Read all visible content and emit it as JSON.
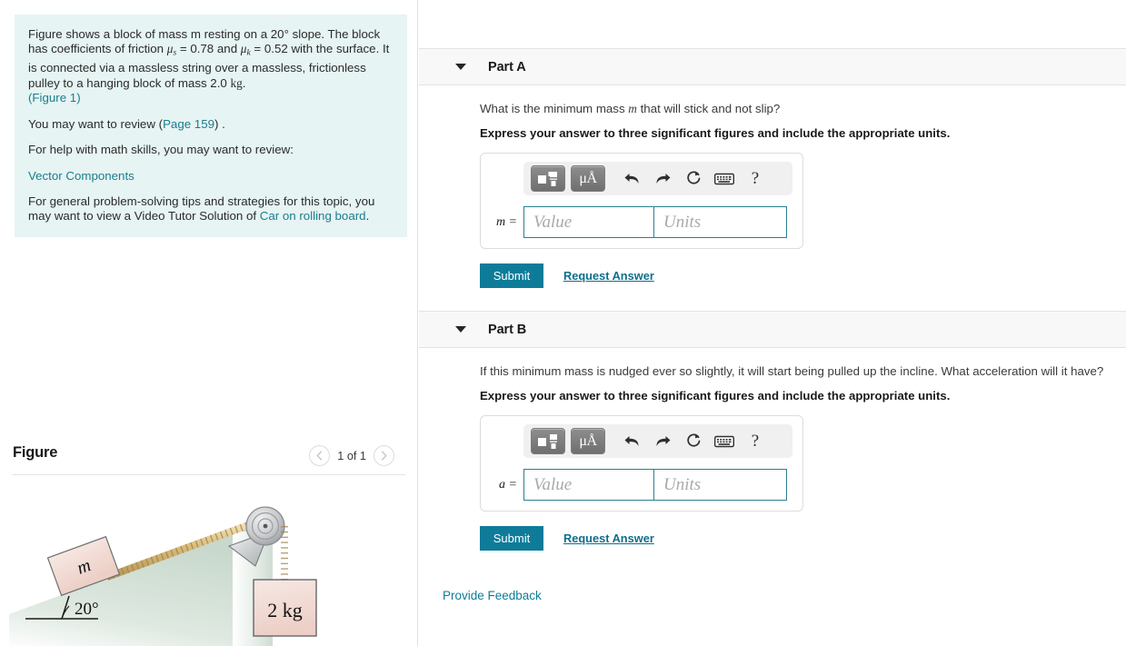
{
  "problem": {
    "paragraph1_a": "Figure shows a block of mass m resting on a 20",
    "paragraph1_deg": "°",
    "paragraph1_b": " slope. The block has coefficients of friction ",
    "mu_symbol": "μ",
    "mu_s_sub": "s",
    "mu_s_value": " = 0.78 and ",
    "mu_k_sub": "k",
    "mu_k_value": " = 0.52 with the surface. It is connected via a massless string over a massless, frictionless pulley to a hanging block of mass 2.0 ",
    "kg_unit": "kg",
    "paragraph1_end": ".",
    "figure_link": "(Figure 1)",
    "review_prefix": "You may want to review (",
    "page_link": "Page 159",
    "review_suffix": ") .",
    "math_skills_text": "For help with math skills, you may want to review:",
    "vector_components_link": "Vector Components",
    "tips_prefix": "For general problem-solving tips and strategies for this topic, you may want to view a Video Tutor Solution of ",
    "video_link": "Car on rolling board",
    "tips_suffix": "."
  },
  "figure": {
    "title": "Figure",
    "pager_label": "1 of 1",
    "prev_icon": "chevron-left-icon",
    "next_icon": "chevron-right-icon",
    "diagram": {
      "block_label": "m",
      "angle_label": "20°",
      "hanging_block_label": "2 kg",
      "incline_color": "#d9e4dc",
      "block_fill": "#f2ded9",
      "rope_color": "#d9bc7f",
      "pulley_color": "#c5c7c9"
    }
  },
  "parts": [
    {
      "id": "part-a",
      "title": "Part A",
      "caret_icon": "caret-down-icon",
      "question": "What is the minimum mass m that will stick and not slip?",
      "question_pre": "What is the minimum mass ",
      "question_var": "m",
      "question_post": " that will stick and not slip?",
      "instruction": "Express your answer to three significant figures and include the appropriate units.",
      "answer_label": "m =",
      "value_placeholder": "Value",
      "units_placeholder": "Units",
      "value_current": "",
      "units_current": "",
      "submit_label": "Submit",
      "request_label": "Request Answer"
    },
    {
      "id": "part-b",
      "title": "Part B",
      "caret_icon": "caret-down-icon",
      "question": "If this minimum mass is nudged ever so slightly, it will start being pulled up the incline. What acceleration will it have?",
      "question_pre": "If this minimum mass is nudged ever so slightly, it will start being pulled up the incline. What acceleration will it have?",
      "question_var": "",
      "question_post": "",
      "instruction": "Express your answer to three significant figures and include the appropriate units.",
      "answer_label": "a =",
      "value_placeholder": "Value",
      "units_placeholder": "Units",
      "value_current": "",
      "units_current": "",
      "submit_label": "Submit",
      "request_label": "Request Answer"
    }
  ],
  "toolbar": {
    "template_icon": "math-template-icon",
    "units_label": "μÅ",
    "undo_icon": "undo-arrow-icon",
    "redo_icon": "redo-arrow-icon",
    "reset_icon": "reset-circle-icon",
    "keyboard_icon": "keyboard-icon",
    "help_label": "?"
  },
  "footer": {
    "provide_feedback": "Provide Feedback"
  },
  "colors": {
    "accent": "#0e7c99",
    "link": "#1b7d8f",
    "panel_bg": "#e6f4f3",
    "header_bg": "#f8f8f8",
    "input_border": "#2a7f92"
  }
}
